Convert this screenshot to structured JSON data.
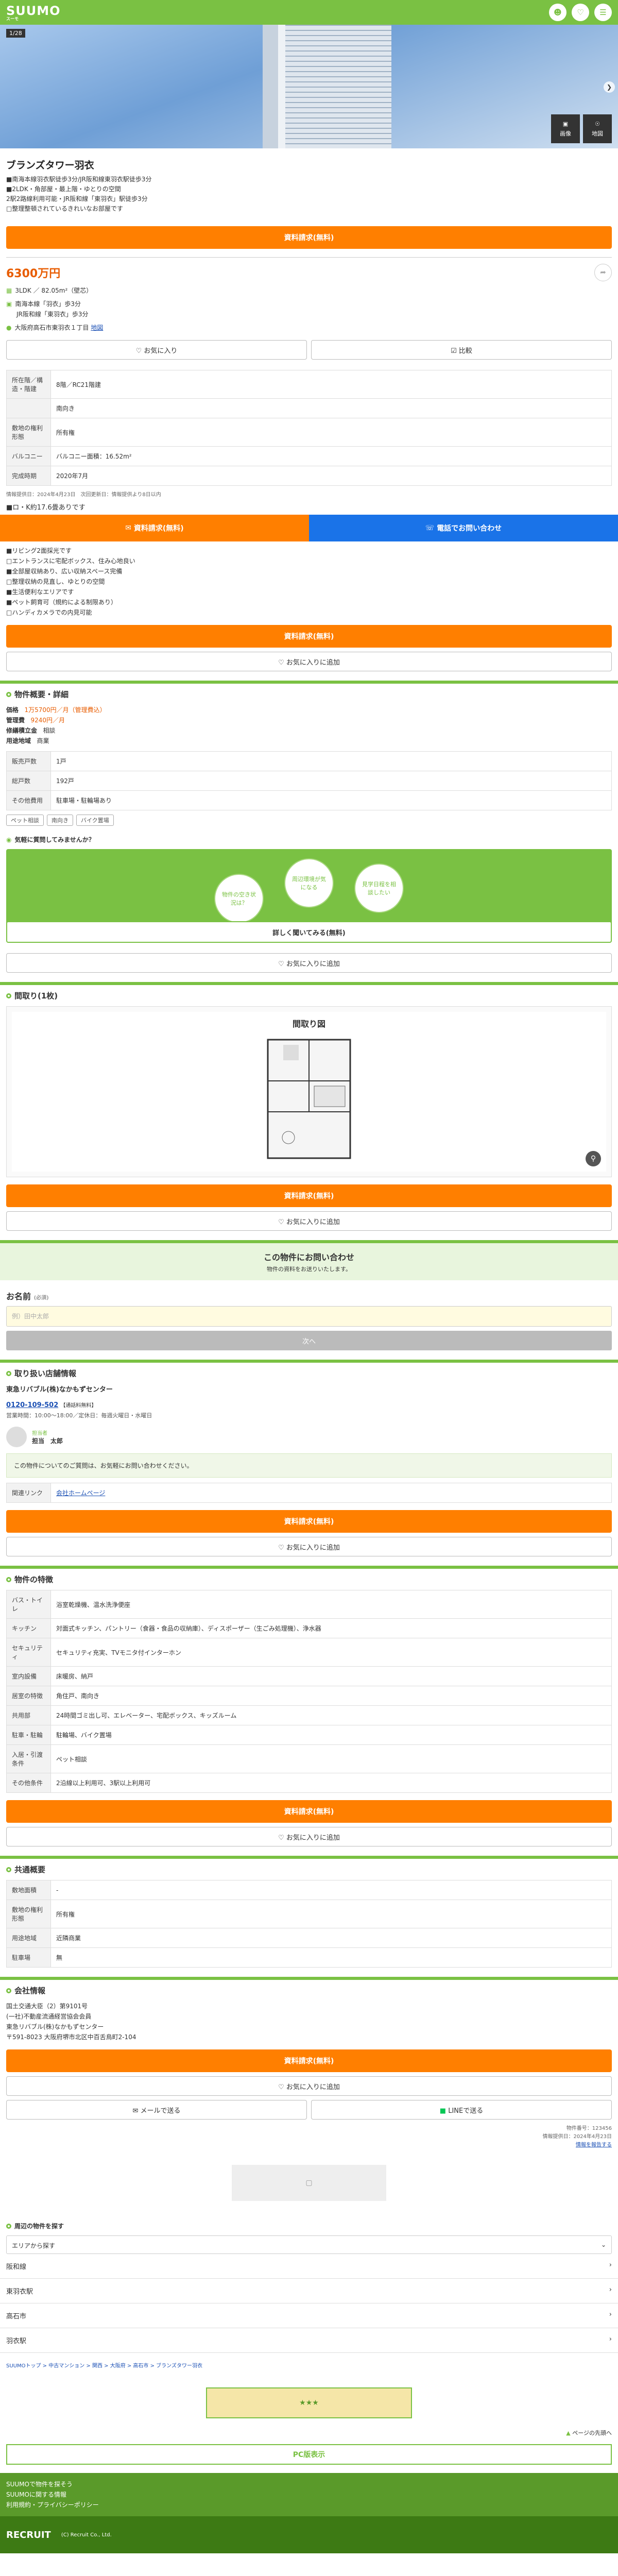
{
  "header": {
    "logo": "SUUMO",
    "logo_sub": "スーモ",
    "icon1": "person-icon",
    "icon2": "heart-icon",
    "icon3": "menu-icon"
  },
  "hero": {
    "tag": "1/28",
    "thumb1": "画像",
    "thumb2": "地図"
  },
  "property": {
    "title": "ブランズタワー羽衣",
    "subs": [
      "■南海本線羽衣駅徒歩3分/JR阪和線東羽衣駅徒歩3分",
      "■2LDK・角部屋・最上階・ゆとりの空間",
      "2駅2路線利用可能・JR阪和線「東羽衣」駅徒歩3分",
      "□整理整頓されているきれいなお部屋です"
    ],
    "inquire": "資料請求(無料)",
    "price": "6300万円",
    "layout": "3LDK ／ 82.05m²（壁芯）",
    "access1": "南海本線「羽衣」歩3分",
    "access2": "JR阪和線「東羽衣」歩3分",
    "address": "大阪府高石市東羽衣１丁目",
    "map_link": "地図",
    "fav": "お気に入り",
    "compare": "比較"
  },
  "spec_table": [
    {
      "k": "所在階／構造・階建",
      "v": "8階／RC21階建"
    },
    {
      "k": "",
      "v": "南向き"
    },
    {
      "k": "敷地の権利形態",
      "v": "所有権"
    },
    {
      "k": "バルコニー",
      "v": "バルコニー面積：16.52m²"
    },
    {
      "k": "完成時期",
      "v": "2020年7月"
    }
  ],
  "info_update": "情報提供日：2024年4月23日　次回更新日：情報提供より8日以内",
  "feature_title": "■ロ・K約17.6畳ありです",
  "sticky": {
    "btn1": "資料請求(無料)",
    "btn2": "電話でお問い合わせ"
  },
  "features": [
    "■リビング2面採光です",
    "□エントランスに宅配ボックス、住み心地良い",
    "■全部屋収納あり、広い収納スペース完備",
    "□整理収納の見直し、ゆとりの空間",
    "■生活便利なエリアです",
    "■ペット飼育可（規約による制限あり）",
    "□ハンディカメラでの内見可能"
  ],
  "fav_btn": "お気に入りに追加",
  "overview": {
    "title": "物件概要・詳細",
    "rows": [
      {
        "k": "価格",
        "v": "1万5700円／月（管理費込）"
      },
      {
        "k": "管理費",
        "v": "9240円／月"
      },
      {
        "k": "修繕積立金",
        "v": "相談"
      },
      {
        "k": "用途地域",
        "v": "商業"
      },
      {
        "k": "販売戸数",
        "v": "1戸"
      },
      {
        "k": "総戸数",
        "v": "192戸"
      },
      {
        "k": "その他費用",
        "v": "駐車場・駐輪場あり"
      }
    ]
  },
  "chips": [
    "ペット相談",
    "南向き",
    "バイク置場"
  ],
  "survey": {
    "title": "気軽に質問してみませんか？",
    "bubbles": [
      "物件の空き状況は？",
      "周辺環境が気になる",
      "見学日程を相談したい"
    ],
    "btn": "詳しく聞いてみる(無料)"
  },
  "floorplan": {
    "title": "間取り(1枚)",
    "label": "間取り図"
  },
  "contact": {
    "title": "この物件にお問い合わせ",
    "sub": "物件の資料をお送りいたします。",
    "name_label": "お名前",
    "req": "(必須)",
    "placeholder": "例）田中太郎",
    "next": "次へ"
  },
  "shop": {
    "title": "取り扱い店舗情報",
    "name": "東急リバブル(株)なかもずセンター",
    "tel": "0120-109-502",
    "tel_note": "【通話料無料】",
    "hours": "営業時間：10:00〜18:00／定休日：毎週火曜日・水曜日",
    "staff_label": "担当者",
    "staff": "担当　太郎",
    "comment": "この物件についてのご質問は、お気軽にお問い合わせください。",
    "section_label": "関連リンク",
    "link": "会社ホームページ"
  },
  "facilities": {
    "title": "物件の特徴",
    "rows": [
      {
        "k": "バス・トイレ",
        "v": "浴室乾燥機、温水洗浄便座"
      },
      {
        "k": "キッチン",
        "v": "対面式キッチン、パントリー（食器・食品の収納庫）、ディスポーザー（生ごみ処理機）、浄水器"
      },
      {
        "k": "セキュリティ",
        "v": "セキュリティ充実、TVモニタ付インターホン"
      },
      {
        "k": "室内設備",
        "v": "床暖房、納戸"
      },
      {
        "k": "居室の特徴",
        "v": "角住戸、南向き"
      },
      {
        "k": "共用部",
        "v": "24時間ゴミ出し可、エレベーター、宅配ボックス、キッズルーム"
      },
      {
        "k": "駐車・駐輪",
        "v": "駐輪場、バイク置場"
      },
      {
        "k": "入居・引渡条件",
        "v": "ペット相談"
      },
      {
        "k": "その他条件",
        "v": "2沿線以上利用可、3駅以上利用可"
      }
    ]
  },
  "common": {
    "title": "共通概要",
    "rows": [
      {
        "k": "敷地面積",
        "v": "-"
      },
      {
        "k": "敷地の権利形態",
        "v": "所有権"
      },
      {
        "k": "用途地域",
        "v": "近隣商業"
      },
      {
        "k": "駐車場",
        "v": "無"
      }
    ]
  },
  "company": {
    "title": "会社情報",
    "lines": [
      "国土交通大臣（2）第9101号",
      "(一社)不動産流通経営協会会員",
      "東急リバブル(株)なかもずセンター",
      "〒591-8023 大阪府堺市北区中百舌鳥町2-104"
    ]
  },
  "share": {
    "mail": "メールで送る",
    "line": "LINEで送る"
  },
  "notes": {
    "code": "物件番号：123456",
    "update": "情報提供日：2024年4月23日",
    "report": "情報を報告する"
  },
  "area": {
    "title": "周辺の物件を探す",
    "select": "エリアから探す",
    "links": [
      "阪和線",
      "東羽衣駅",
      "高石市",
      "羽衣駅"
    ]
  },
  "breadcrumb": "SUUMOトップ > 中古マンション > 関西 > 大阪府 > 高石市 > ブランズタワー羽衣",
  "pagetop": "ページの先頭へ",
  "pc": "PC版表示",
  "footer_lines": [
    "SUUMOで物件を探そう",
    "SUUMOに関する情報",
    "利用規約・プライバシーポリシー"
  ],
  "recruit": "RECRUIT",
  "copyright": "(C) Recruit Co., Ltd."
}
